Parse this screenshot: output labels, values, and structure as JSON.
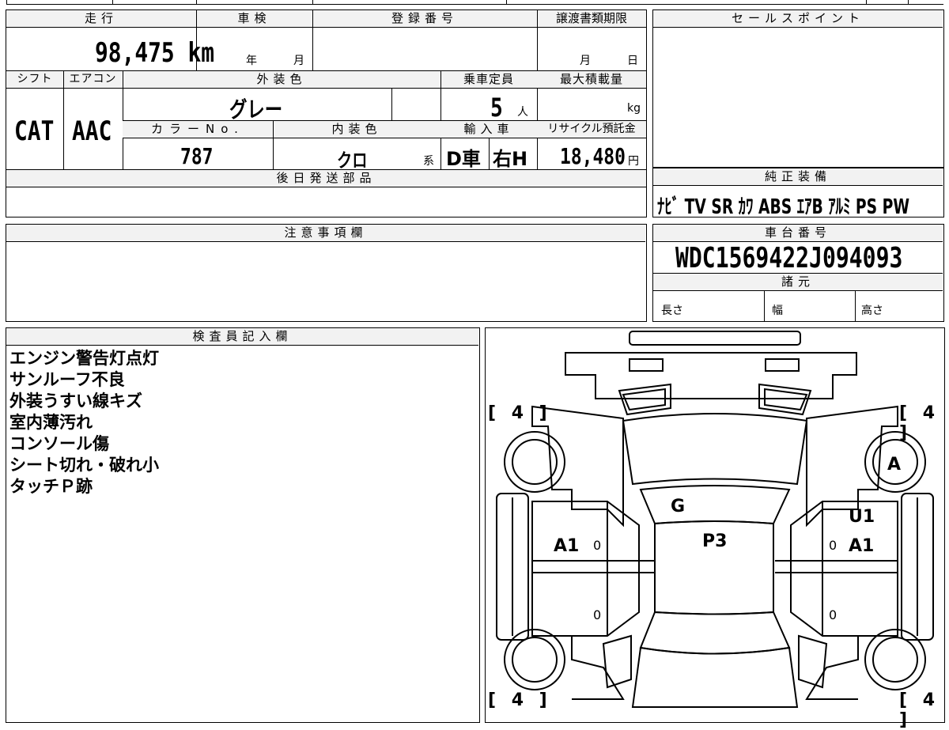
{
  "top_row": {
    "mileage_label": "走行",
    "mileage_value": "98,475 km",
    "inspection_label": "車検",
    "inspection_year": "年",
    "inspection_month": "月",
    "registration_label": "登録番号",
    "transfer_deadline_label": "譲渡書類期限",
    "transfer_month": "月",
    "transfer_day": "日",
    "sales_point_label": "セールスポイント"
  },
  "second_row": {
    "shift_label": "シフト",
    "shift_value": "CAT",
    "aircon_label": "エアコン",
    "aircon_value": "AAC",
    "exterior_color_label": "外装色",
    "exterior_color_value": "グレー",
    "capacity_label": "乗車定員",
    "capacity_value": "5",
    "capacity_unit": "人",
    "max_load_label": "最大積載量",
    "max_load_unit": "kg",
    "color_no_label": "カラーNo.",
    "color_no_value": "787",
    "interior_color_label": "内装色",
    "interior_color_value": "クロ",
    "interior_suffix": "系",
    "import_label": "輸入車",
    "import_value_1": "D車",
    "import_value_2": "右H",
    "recycle_label": "リサイクル預託金",
    "recycle_value": "18,480",
    "recycle_unit": "円"
  },
  "later_parts_label": "後日発送部品",
  "genuine_equipment_label": "純正装備",
  "genuine_equipment_value": "ﾅﾋﾞ TV SR ｶﾜ ABS ｴｱB ｱﾙﾐ PS PW",
  "caution_label": "注意事項欄",
  "chassis_label": "車台番号",
  "chassis_value": "WDC1569422J094093",
  "specs_label": "諸元",
  "specs": {
    "length": "長さ",
    "width": "幅",
    "height": "高さ"
  },
  "inspector_label": "検査員記入欄",
  "inspector_notes": [
    "エンジン警告灯点灯",
    "サンルーフ不良",
    "外装うすい線キズ",
    "室内薄汚れ",
    "コンソール傷",
    "シート切れ・破れ小",
    "タッチＰ跡"
  ],
  "diagram": {
    "tire_front_left": "[ 4 ]",
    "tire_front_right": "[ 4 ]",
    "tire_rear_left": "[ 4 ]",
    "tire_rear_right": "[ 4 ]",
    "mark_wheel_right": "A",
    "mark_windshield": "G",
    "mark_roof": "P3",
    "mark_left_front_door": "A1",
    "mark_right_u": "U1",
    "mark_right_front_door": "A1",
    "zero_1": "0",
    "zero_2": "0",
    "zero_3": "0",
    "zero_4": "0"
  }
}
